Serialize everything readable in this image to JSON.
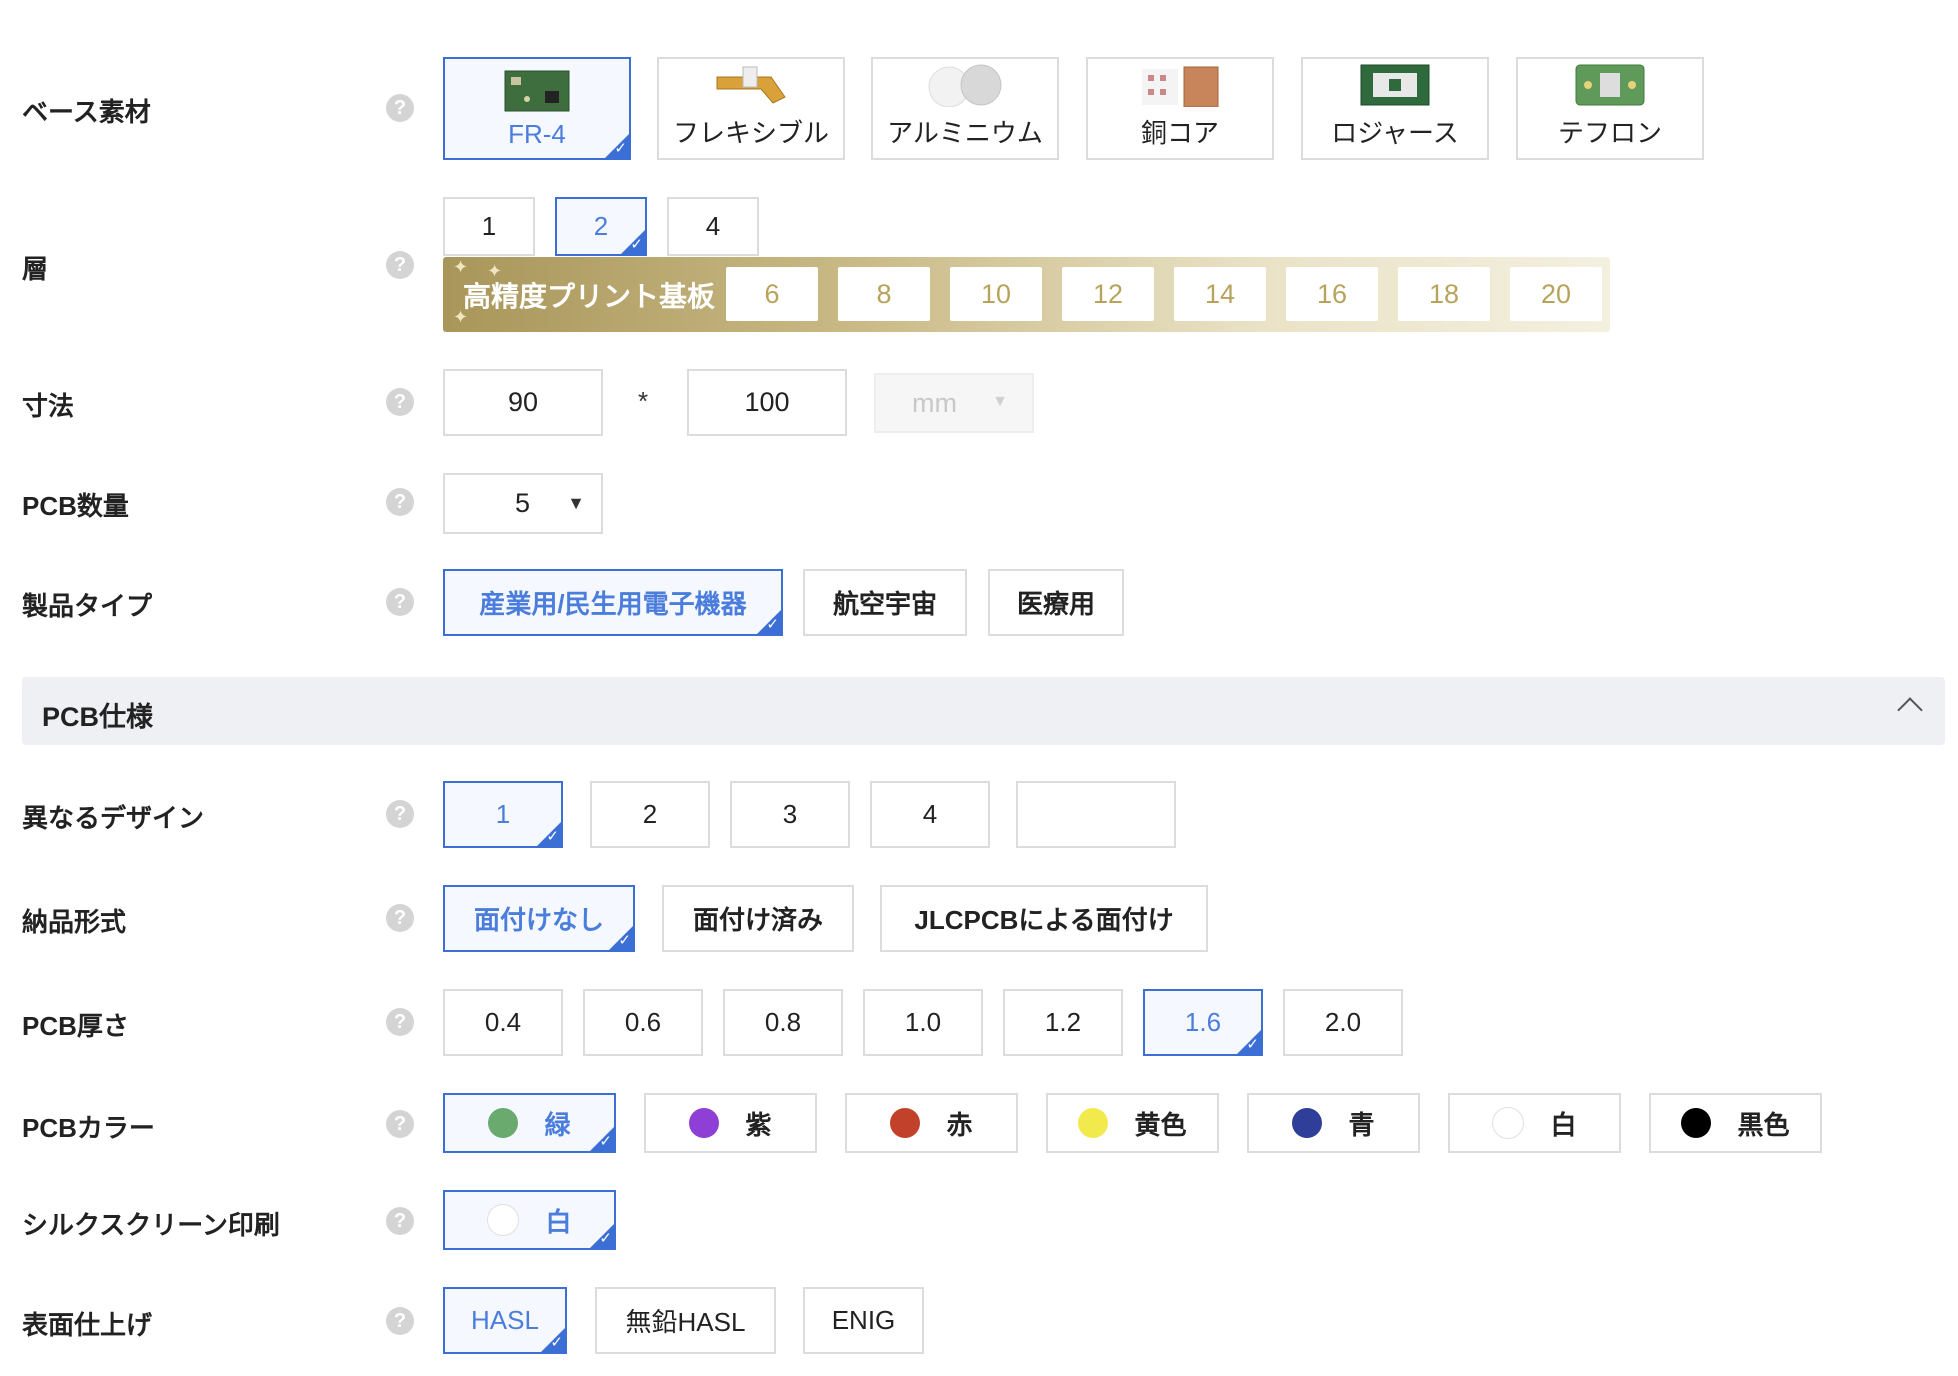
{
  "labels": {
    "base_material": "ベース素材",
    "layers": "層",
    "dimensions": "寸法",
    "pcb_qty": "PCB数量",
    "product_type": "製品タイプ",
    "different_design": "異なるデザイン",
    "delivery_format": "納品形式",
    "pcb_thickness": "PCB厚さ",
    "pcb_color": "PCBカラー",
    "silkscreen": "シルクスクリーン印刷",
    "surface_finish": "表面仕上げ"
  },
  "help_glyph": "?",
  "check_glyph": "✓",
  "base_material": {
    "options": [
      "FR-4",
      "フレキシブル",
      "アルミニウム",
      "銅コア",
      "ロジャース",
      "テフロン"
    ],
    "selected": "FR-4"
  },
  "layers": {
    "options": [
      "1",
      "2",
      "4"
    ],
    "selected": "2",
    "hdi_title": "高精度プリント基板",
    "hdi_options": [
      "6",
      "8",
      "10",
      "12",
      "14",
      "16",
      "18",
      "20"
    ],
    "sparkle": "✦"
  },
  "dimensions": {
    "width": "90",
    "separator": "*",
    "height": "100",
    "unit": "mm",
    "unit_arrow": "▼"
  },
  "pcb_qty": {
    "value": "5",
    "arrow": "▼"
  },
  "product_type": {
    "options": [
      "産業用/民生用電子機器",
      "航空宇宙",
      "医療用"
    ],
    "selected": "産業用/民生用電子機器"
  },
  "section": {
    "title": "PCB仕様",
    "state": "expanded"
  },
  "different_design": {
    "options": [
      "1",
      "2",
      "3",
      "4",
      ""
    ],
    "selected": "1"
  },
  "delivery_format": {
    "options": [
      "面付けなし",
      "面付け済み",
      "JLCPCBによる面付け"
    ],
    "selected": "面付けなし"
  },
  "pcb_thickness": {
    "options": [
      "0.4",
      "0.6",
      "0.8",
      "1.0",
      "1.2",
      "1.6",
      "2.0"
    ],
    "selected": "1.6"
  },
  "pcb_color": {
    "options": [
      {
        "label": "緑",
        "color": "#6aaa6e"
      },
      {
        "label": "紫",
        "color": "#8e3fd6"
      },
      {
        "label": "赤",
        "color": "#c2412a"
      },
      {
        "label": "黄色",
        "color": "#f2ea4c"
      },
      {
        "label": "青",
        "color": "#2e3e99"
      },
      {
        "label": "白",
        "color": "#ffffff"
      },
      {
        "label": "黒色",
        "color": "#000000"
      }
    ],
    "selected": "緑"
  },
  "silkscreen": {
    "options": [
      {
        "label": "白",
        "color": "#ffffff"
      }
    ],
    "selected": "白"
  },
  "surface_finish": {
    "options": [
      "HASL",
      "無鉛HASL",
      "ENIG"
    ],
    "selected": "HASL"
  },
  "colors": {
    "accent": "#3b6fd6",
    "hdi_gold": "#b8a35c"
  }
}
